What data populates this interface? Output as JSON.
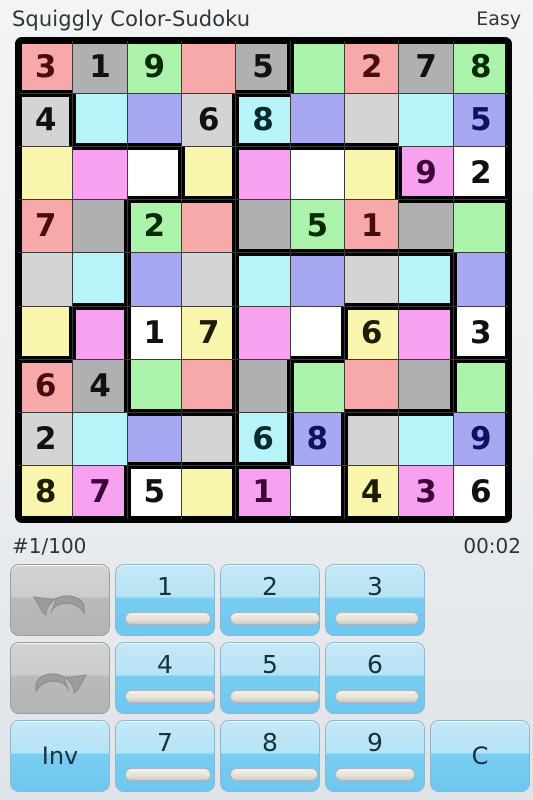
{
  "header": {
    "title": "Squiggly Color-Sudoku",
    "difficulty": "Easy"
  },
  "status": {
    "puzzle_number": "#1/100",
    "timer": "00:02"
  },
  "board": {
    "rows": 9,
    "cols": 9,
    "palette": {
      "pink": "#f7a8a8",
      "gray": "#b0b0b0",
      "green": "#acf3ac",
      "silver": "#d4d4d2",
      "cyan": "#b6f4fa",
      "blue": "#a7a7f2",
      "yellow": "#fbf6ae",
      "magenta": "#f7a2f0",
      "white": "#ffffff"
    },
    "digit_colors": {
      "pink": "#4a0d0d",
      "gray": "#111111",
      "green": "#062b06",
      "silver": "#111111",
      "cyan": "#052b2e",
      "blue": "#101060",
      "yellow": "#201c00",
      "magenta": "#3d043a",
      "white": "#111111"
    },
    "cells": [
      [
        {
          "v": "3",
          "c": "pink"
        },
        {
          "v": "1",
          "c": "gray"
        },
        {
          "v": "9",
          "c": "green"
        },
        {
          "v": "",
          "c": "pink"
        },
        {
          "v": "5",
          "c": "gray"
        },
        {
          "v": "",
          "c": "green"
        },
        {
          "v": "2",
          "c": "pink"
        },
        {
          "v": "7",
          "c": "gray"
        },
        {
          "v": "8",
          "c": "green"
        }
      ],
      [
        {
          "v": "4",
          "c": "silver"
        },
        {
          "v": "",
          "c": "cyan"
        },
        {
          "v": "",
          "c": "blue"
        },
        {
          "v": "6",
          "c": "silver"
        },
        {
          "v": "8",
          "c": "cyan"
        },
        {
          "v": "",
          "c": "blue"
        },
        {
          "v": "",
          "c": "silver"
        },
        {
          "v": "",
          "c": "cyan"
        },
        {
          "v": "5",
          "c": "blue"
        }
      ],
      [
        {
          "v": "",
          "c": "yellow"
        },
        {
          "v": "",
          "c": "magenta"
        },
        {
          "v": "",
          "c": "white"
        },
        {
          "v": "",
          "c": "yellow"
        },
        {
          "v": "",
          "c": "magenta"
        },
        {
          "v": "",
          "c": "white"
        },
        {
          "v": "",
          "c": "yellow"
        },
        {
          "v": "9",
          "c": "magenta"
        },
        {
          "v": "2",
          "c": "white"
        }
      ],
      [
        {
          "v": "7",
          "c": "pink"
        },
        {
          "v": "",
          "c": "gray"
        },
        {
          "v": "2",
          "c": "green"
        },
        {
          "v": "",
          "c": "pink"
        },
        {
          "v": "",
          "c": "gray"
        },
        {
          "v": "5",
          "c": "green"
        },
        {
          "v": "1",
          "c": "pink"
        },
        {
          "v": "",
          "c": "gray"
        },
        {
          "v": "",
          "c": "green"
        }
      ],
      [
        {
          "v": "",
          "c": "silver"
        },
        {
          "v": "",
          "c": "cyan"
        },
        {
          "v": "",
          "c": "blue"
        },
        {
          "v": "",
          "c": "silver"
        },
        {
          "v": "",
          "c": "cyan"
        },
        {
          "v": "",
          "c": "blue"
        },
        {
          "v": "",
          "c": "silver"
        },
        {
          "v": "",
          "c": "cyan"
        },
        {
          "v": "",
          "c": "blue"
        }
      ],
      [
        {
          "v": "",
          "c": "yellow"
        },
        {
          "v": "",
          "c": "magenta"
        },
        {
          "v": "1",
          "c": "white"
        },
        {
          "v": "7",
          "c": "yellow"
        },
        {
          "v": "",
          "c": "magenta"
        },
        {
          "v": "",
          "c": "white"
        },
        {
          "v": "6",
          "c": "yellow"
        },
        {
          "v": "",
          "c": "magenta"
        },
        {
          "v": "3",
          "c": "white"
        }
      ],
      [
        {
          "v": "6",
          "c": "pink"
        },
        {
          "v": "4",
          "c": "gray"
        },
        {
          "v": "",
          "c": "green"
        },
        {
          "v": "",
          "c": "pink"
        },
        {
          "v": "",
          "c": "gray"
        },
        {
          "v": "",
          "c": "green"
        },
        {
          "v": "",
          "c": "pink"
        },
        {
          "v": "",
          "c": "gray"
        },
        {
          "v": "",
          "c": "green"
        }
      ],
      [
        {
          "v": "2",
          "c": "silver"
        },
        {
          "v": "",
          "c": "cyan"
        },
        {
          "v": "",
          "c": "blue"
        },
        {
          "v": "",
          "c": "silver"
        },
        {
          "v": "6",
          "c": "cyan"
        },
        {
          "v": "8",
          "c": "blue"
        },
        {
          "v": "",
          "c": "silver"
        },
        {
          "v": "",
          "c": "cyan"
        },
        {
          "v": "9",
          "c": "blue"
        }
      ],
      [
        {
          "v": "8",
          "c": "yellow"
        },
        {
          "v": "7",
          "c": "magenta"
        },
        {
          "v": "5",
          "c": "white"
        },
        {
          "v": "",
          "c": "yellow"
        },
        {
          "v": "1",
          "c": "magenta"
        },
        {
          "v": "",
          "c": "white"
        },
        {
          "v": "4",
          "c": "yellow"
        },
        {
          "v": "3",
          "c": "magenta"
        },
        {
          "v": "6",
          "c": "white"
        }
      ]
    ],
    "regions": [
      [
        1,
        1,
        1,
        1,
        1,
        2,
        2,
        2,
        2
      ],
      [
        3,
        1,
        1,
        1,
        2,
        2,
        2,
        2,
        2
      ],
      [
        3,
        3,
        3,
        1,
        4,
        4,
        4,
        2,
        2
      ],
      [
        3,
        3,
        5,
        5,
        4,
        4,
        4,
        4,
        4
      ],
      [
        3,
        3,
        5,
        5,
        6,
        6,
        6,
        6,
        4
      ],
      [
        3,
        7,
        5,
        5,
        6,
        6,
        8,
        8,
        4
      ],
      [
        7,
        7,
        5,
        5,
        6,
        8,
        8,
        8,
        9
      ],
      [
        7,
        7,
        7,
        7,
        6,
        8,
        9,
        9,
        9
      ],
      [
        7,
        7,
        5,
        5,
        8,
        8,
        9,
        9,
        9
      ]
    ]
  },
  "keypad": {
    "undo_label": "undo",
    "redo_label": "redo",
    "inv_label": "Inv",
    "clear_label": "C",
    "numbers": [
      {
        "label": "1",
        "fill": 88
      },
      {
        "label": "2",
        "fill": 92
      },
      {
        "label": "3",
        "fill": 86
      },
      {
        "label": "4",
        "fill": 92
      },
      {
        "label": "5",
        "fill": 92
      },
      {
        "label": "6",
        "fill": 86
      },
      {
        "label": "7",
        "fill": 88
      },
      {
        "label": "8",
        "fill": 90
      },
      {
        "label": "9",
        "fill": 82
      }
    ]
  }
}
